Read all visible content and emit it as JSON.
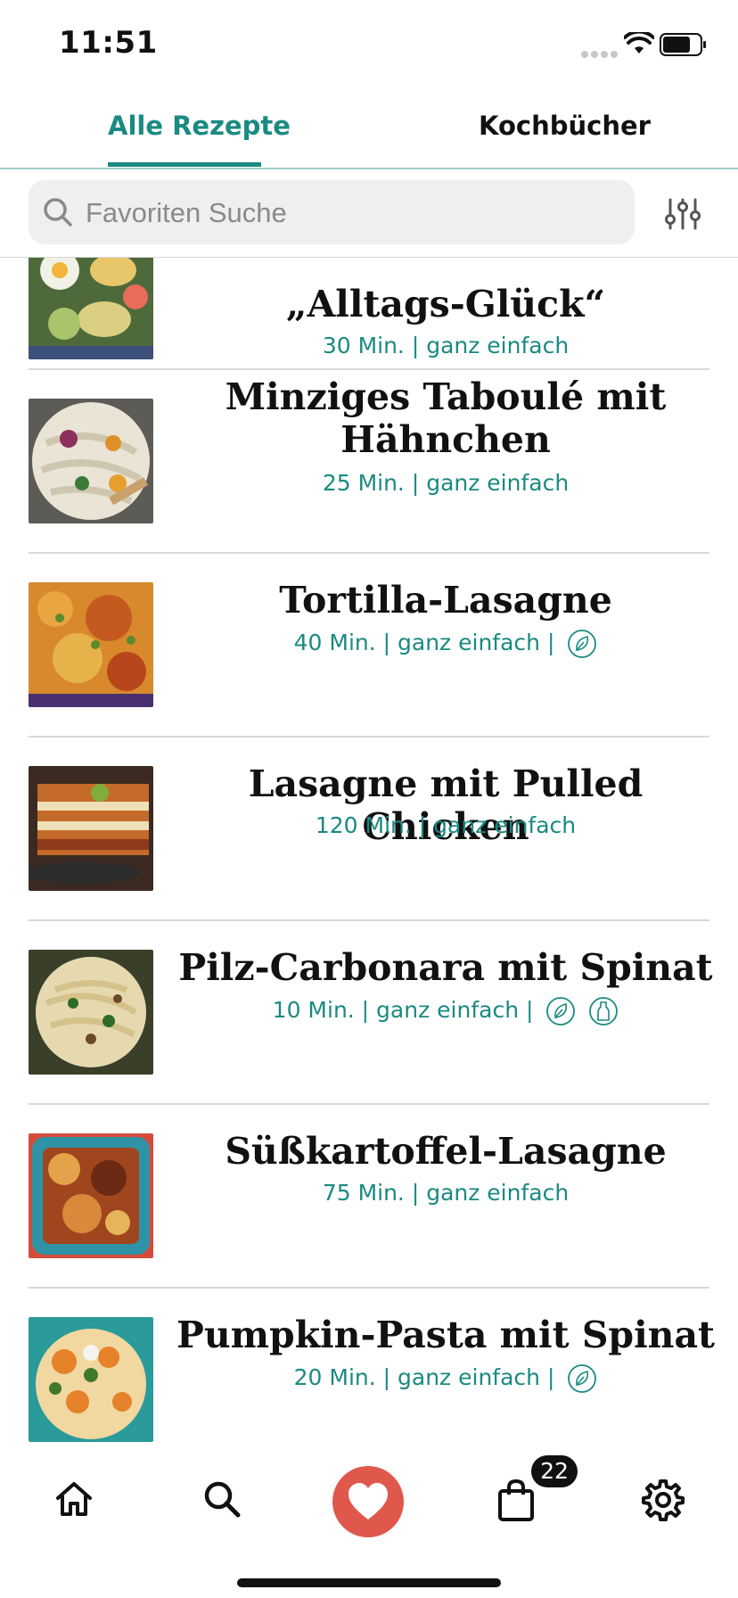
{
  "status_bar": {
    "time": "11:51"
  },
  "tabs": [
    {
      "label": "Alle Rezepte",
      "active": true
    },
    {
      "label": "Kochbücher",
      "active": false
    }
  ],
  "search": {
    "placeholder": "Favoriten Suche",
    "value": ""
  },
  "recipes": [
    {
      "title": "„Alltags-Glück“",
      "meta": "30 Min. | ganz einfach",
      "badges": []
    },
    {
      "title": "Minziges Taboulé mit Hähnchen",
      "meta": "25 Min. | ganz einfach",
      "badges": []
    },
    {
      "title": "Tortilla-Lasagne",
      "meta": "40 Min. | ganz einfach |",
      "badges": [
        "leaf-icon"
      ]
    },
    {
      "title": "Lasagne mit Pulled Chicken",
      "meta": "120 Min. | ganz einfach",
      "badges": []
    },
    {
      "title": "Pilz-Carbonara mit Spinat",
      "meta": "10 Min. | ganz einfach |",
      "badges": [
        "leaf-icon",
        "bottle-icon"
      ]
    },
    {
      "title": "Süßkartoffel-Lasagne",
      "meta": "75 Min. | ganz einfach",
      "badges": []
    },
    {
      "title": "Pumpkin-Pasta mit Spinat",
      "meta": "20 Min. | ganz einfach |",
      "badges": [
        "leaf-icon"
      ]
    }
  ],
  "tabbar": {
    "items": [
      "home-icon",
      "search-icon",
      "heart-icon",
      "shopping-bag-icon",
      "settings-gear-icon"
    ],
    "cart_count": "22"
  },
  "colors": {
    "accent": "#1a8a82",
    "favorite": "#e0584b"
  }
}
